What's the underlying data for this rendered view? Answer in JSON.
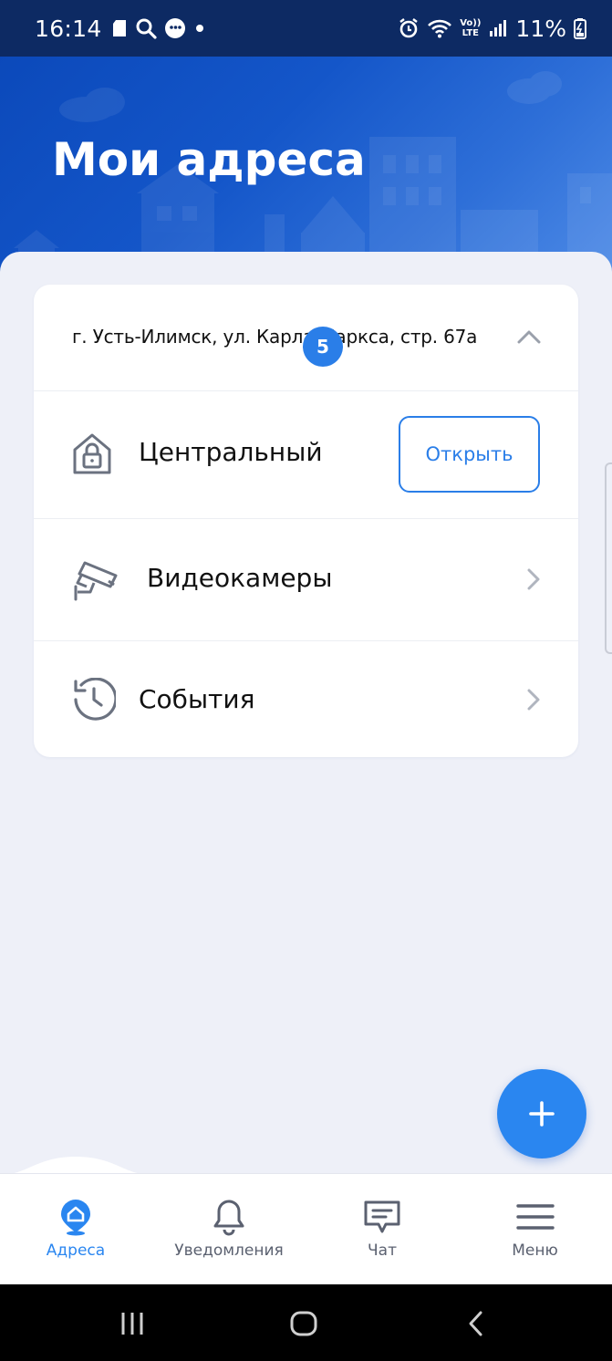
{
  "status_bar": {
    "time": "16:14",
    "battery": "11%",
    "lte": "LTE",
    "volte": "Vo))"
  },
  "header": {
    "title": "Мои адреса"
  },
  "address_card": {
    "address": "г. Усть-Илимск, ул. Карла Маркса, стр. 67а",
    "rows": [
      {
        "label": "Центральный",
        "icon": "locked-house-icon",
        "action_label": "Открыть"
      },
      {
        "label": "Видеокамеры",
        "icon": "security-camera-icon",
        "badge": "5"
      },
      {
        "label": "События",
        "icon": "history-clock-icon"
      }
    ]
  },
  "fab": {
    "icon": "plus-icon"
  },
  "bottom_nav": {
    "items": [
      {
        "label": "Адреса",
        "icon": "address-pin-icon",
        "active": true
      },
      {
        "label": "Уведомления",
        "icon": "bell-icon",
        "active": false
      },
      {
        "label": "Чат",
        "icon": "chat-icon",
        "active": false
      },
      {
        "label": "Меню",
        "icon": "menu-icon",
        "active": false
      }
    ]
  },
  "colors": {
    "accent": "#2a86f0",
    "header_dark": "#0a47b8",
    "statusbar": "#0d2a63",
    "background": "#eef0f8",
    "text": "#111111",
    "nav_inactive": "#5b6170",
    "icon_gray": "#6b7280"
  }
}
